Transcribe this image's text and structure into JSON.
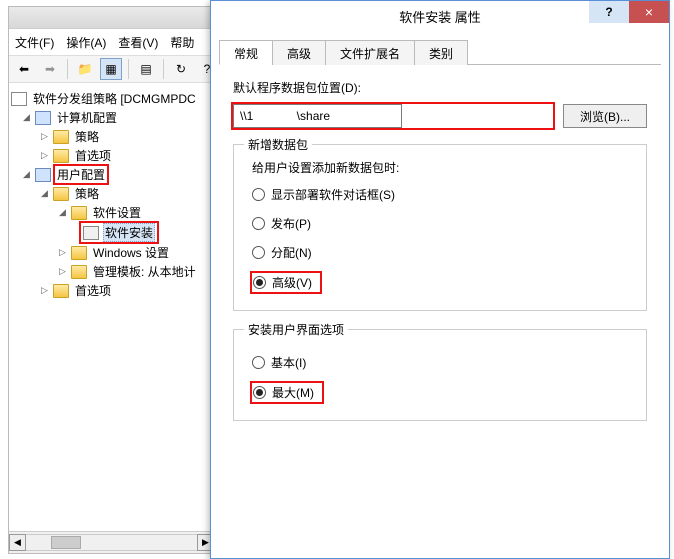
{
  "menu": {
    "file": "文件(F)",
    "action": "操作(A)",
    "view": "查看(V)",
    "help": "帮助"
  },
  "tree": {
    "root": "软件分发组策略 [DCMGMPDC",
    "computer_config": "计算机配置",
    "policy": "策略",
    "pref": "首选项",
    "user_config": "用户配置",
    "software_settings": "软件设置",
    "software_install": "软件安装",
    "windows_settings": "Windows 设置",
    "admin_templates": "管理模板: 从本地计"
  },
  "dialog": {
    "title": "软件安装 属性",
    "help": "?",
    "close": "×",
    "tabs": {
      "general": "常规",
      "advanced": "高级",
      "file_ext": "文件扩展名",
      "category": "类别"
    },
    "path_label": "默认程序数据包位置(D):",
    "path_value": "\\\\1             \\share",
    "browse": "浏览(B)...",
    "group_new": {
      "title": "新增数据包",
      "subtitle": "给用户设置添加新数据包时:",
      "opt_show": "显示部署软件对话框(S)",
      "opt_publish": "发布(P)",
      "opt_assign": "分配(N)",
      "opt_advanced": "高级(V)"
    },
    "group_ui": {
      "title": "安装用户界面选项",
      "opt_basic": "基本(I)",
      "opt_max": "最大(M)"
    }
  }
}
